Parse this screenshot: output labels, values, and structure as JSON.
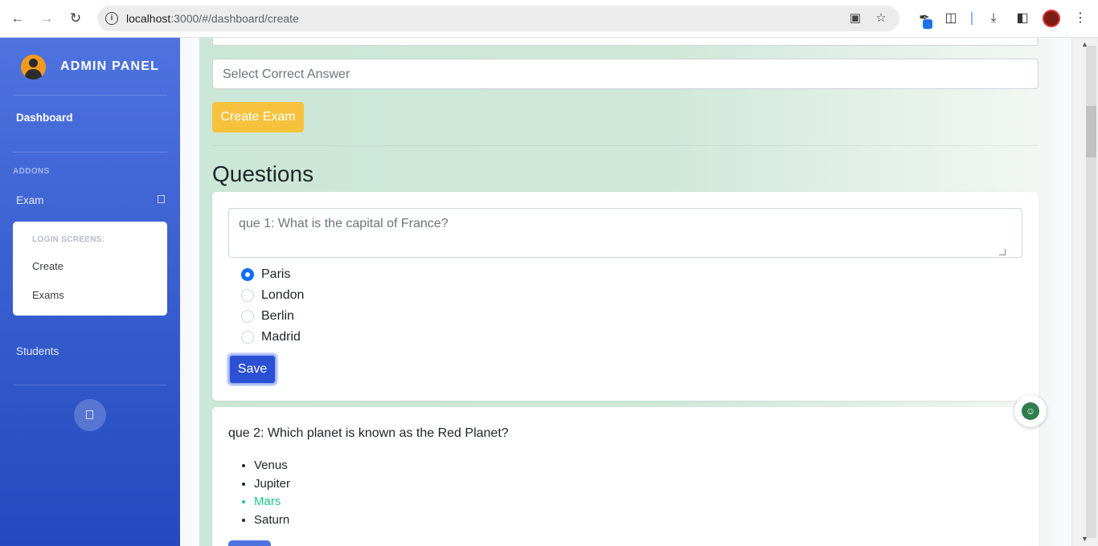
{
  "browser": {
    "url_host": "localhost",
    "url_rest": ":3000/#/dashboard/create",
    "icons": [
      "back-icon",
      "forward-icon",
      "reload-icon",
      "site-info-icon",
      "install-app-icon",
      "bookmark-star-icon",
      "extension-icon",
      "puzzle-icon",
      "download-icon",
      "side-panel-icon",
      "profile-avatar",
      "menu-dots-icon"
    ]
  },
  "sidebar": {
    "brand": "ADMIN PANEL",
    "dashboard_label": "Dashboard",
    "addons_heading": "ADDONS",
    "exam_label": "Exam",
    "submenu": {
      "heading": "LOGIN SCREENS:",
      "items": [
        "Create",
        "Exams"
      ]
    },
    "students_label": "Students"
  },
  "form": {
    "select_placeholder": "Select Correct Answer",
    "create_button": "Create Exam"
  },
  "questions": {
    "title": "Questions",
    "q1": {
      "text": "que 1: What is the capital of France?",
      "options": [
        "Paris",
        "London",
        "Berlin",
        "Madrid"
      ],
      "selected": "Paris",
      "save_label": "Save"
    },
    "q2": {
      "text": "que 2: Which planet is known as the Red Planet?",
      "options": [
        "Venus",
        "Jupiter",
        "Mars",
        "Saturn"
      ],
      "correct": "Mars"
    }
  },
  "colors": {
    "sidebar_top": "#4e73df",
    "sidebar_bottom": "#224abe",
    "create_button": "#f6c23e",
    "save_button": "#2b50d3",
    "radio_selected": "#0d6efd",
    "correct_answer": "#1cc88a"
  }
}
